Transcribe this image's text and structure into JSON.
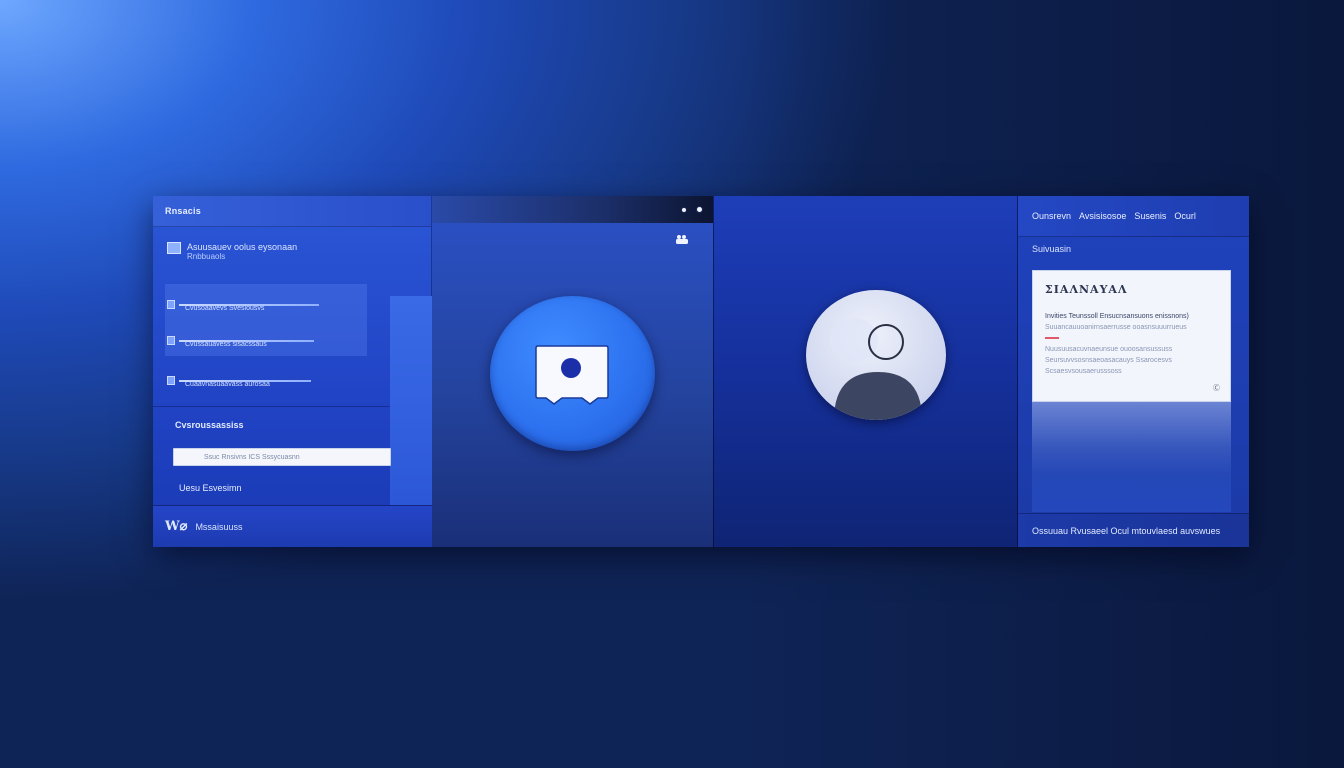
{
  "left_panel": {
    "header": "Rnsacis",
    "profile": {
      "line1": "Asuusauev oolus eysonaan",
      "line2": "Rnbbuaols"
    },
    "list_items": [
      "Cvusoaavevs Svesiousvs",
      "Cvussauavess sisacssaus",
      "Cuaavnasuaavass aurosaa"
    ],
    "section_title": "Cvsroussassiss",
    "input_value": "Ssuc Rnsivns ICS Sssycuasnn",
    "link": "Uesu Esvesimn",
    "footer_label": "Mssaisuuss"
  },
  "center_panel": {
    "window_controls": [
      "minimize",
      "close"
    ]
  },
  "right_panel": {
    "header_items": [
      "Ounsrevn",
      "Avsisisosoe",
      "Susenis",
      "Ocurl"
    ],
    "section": "Suivuasin",
    "card": {
      "title": "ΣΙΑΛΝΑΥΑΛ",
      "line1": "Invities Teunssoll Ensucnsansuons enissnons)",
      "line2": "Suuancauuoanirnsaerrusse ooasnsuuurrueus",
      "line3": "Nuusuusacuvnaeunsue ouoosansussuss",
      "line4": "Seursuvvsosnsaeoasacauys Ssarocesvs",
      "line5": "Scsaesvsousaerusssoss",
      "corner": "Ⓒ"
    },
    "footer": "Ossuuau Rvusaeel Ocul mtouvlaesd auvswues"
  },
  "colors": {
    "background_top_left": "#6ea8ff",
    "background_bottom_right": "#0f2456",
    "panel_blue": "#2043c4",
    "chat_button_blue": "#2d72f0",
    "card_white": "#f2f5fb",
    "accent_red": "#e05a6a"
  },
  "icons": {
    "chat": "chat-bubble-icon",
    "avatar": "user-avatar-icon",
    "person": "person-icon",
    "logo": "app-logo-icon"
  }
}
